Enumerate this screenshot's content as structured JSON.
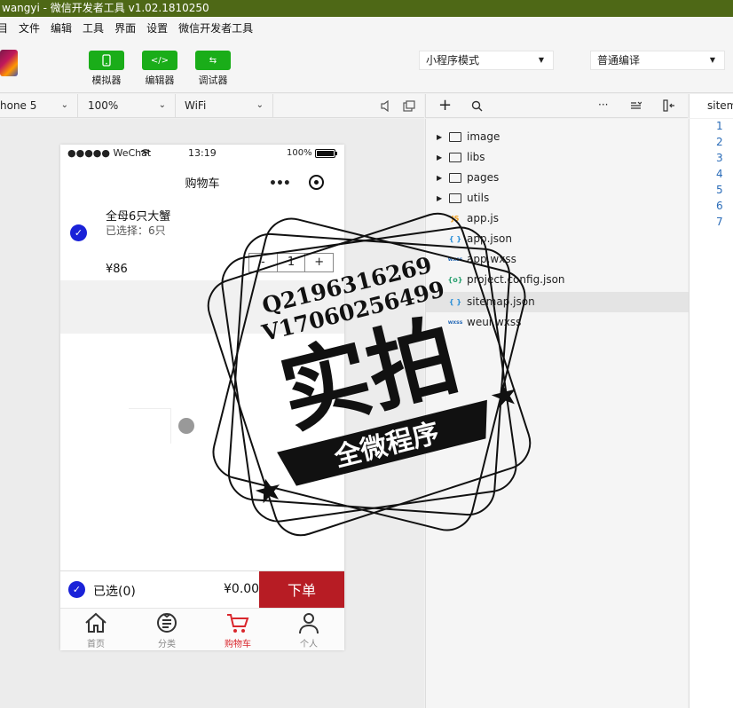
{
  "window": {
    "title": "wangyi - 微信开发者工具 v1.02.1810250"
  },
  "menu": [
    "目",
    "文件",
    "编辑",
    "工具",
    "界面",
    "设置",
    "微信开发者工具"
  ],
  "toolbar": {
    "buttons": [
      {
        "label": "模拟器",
        "icon": "phone-icon"
      },
      {
        "label": "编辑器",
        "icon": "code-icon"
      },
      {
        "label": "调试器",
        "icon": "debug-icon"
      }
    ],
    "mode_select": "小程序模式",
    "compile_select": "普通编译"
  },
  "device_bar": {
    "device": "hone 5",
    "zoom": "100%",
    "network": "WiFi"
  },
  "phone": {
    "status": {
      "carrier": "●●●●● WeChat",
      "time": "13:19",
      "battery": "100%"
    },
    "nav_title": "购物车",
    "item": {
      "name": "全母6只大蟹",
      "selected": "已选择：6只",
      "price": "¥86",
      "qty_minus": "-",
      "qty": "1",
      "qty_plus": "+"
    },
    "bottom": {
      "select_all": "已选(0)",
      "total": "¥0.00",
      "order": "下单"
    },
    "tabs": [
      {
        "label": "首页",
        "icon": "home-icon"
      },
      {
        "label": "分类",
        "icon": "category-icon"
      },
      {
        "label": "购物车",
        "icon": "cart-icon"
      },
      {
        "label": "个人",
        "icon": "person-icon"
      }
    ]
  },
  "tree": {
    "folders": [
      "image",
      "libs",
      "pages",
      "utils"
    ],
    "files": [
      {
        "name": "app.js",
        "type": "JS",
        "color": "#f0a020"
      },
      {
        "name": "app.json",
        "type": "{ }",
        "color": "#2a8fd8"
      },
      {
        "name": "app.wxss",
        "type": "wxss",
        "color": "#2a6cb8"
      },
      {
        "name": "project.config.json",
        "type": "{o}",
        "color": "#2aa070"
      },
      {
        "name": "sitemap.json",
        "type": "{ }",
        "color": "#2a8fd8"
      },
      {
        "name": "weui.wxss",
        "type": "wxss",
        "color": "#2a6cb8"
      }
    ]
  },
  "code": {
    "tab": "sitemap",
    "lines": [
      "1",
      "2",
      "3",
      "4",
      "5",
      "6",
      "7"
    ]
  },
  "watermark": {
    "q": "Q2196316269",
    "v": "V17060256499",
    "main": "实拍",
    "banner": "全微程序"
  }
}
